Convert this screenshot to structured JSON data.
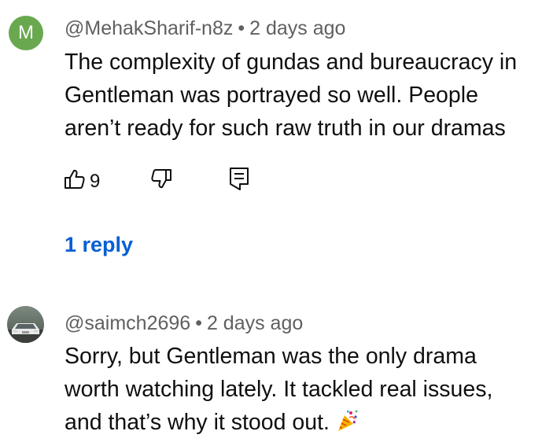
{
  "comments": [
    {
      "avatar_letter": "M",
      "avatar_color": "#6aa84f",
      "author": "@MehakSharif-n8z",
      "separator": "•",
      "time": "2 days ago",
      "lines": [
        "The complexity of gundas and bureaucracy in",
        "Gentleman was portrayed so well. People",
        "aren’t ready for such raw truth in our dramas"
      ],
      "like_count": "9",
      "reply_label": "1 reply"
    },
    {
      "author": "@saimch2696",
      "separator": "•",
      "time": "2 days ago",
      "lines": [
        "Sorry, but Gentleman was the only drama",
        "worth watching lately. It tackled real issues,",
        "and that’s why it stood out."
      ],
      "emoji_icon": "party-popper-icon"
    }
  ],
  "colors": {
    "link": "#065fd4",
    "meta": "#606060",
    "text": "#0f0f0f"
  }
}
